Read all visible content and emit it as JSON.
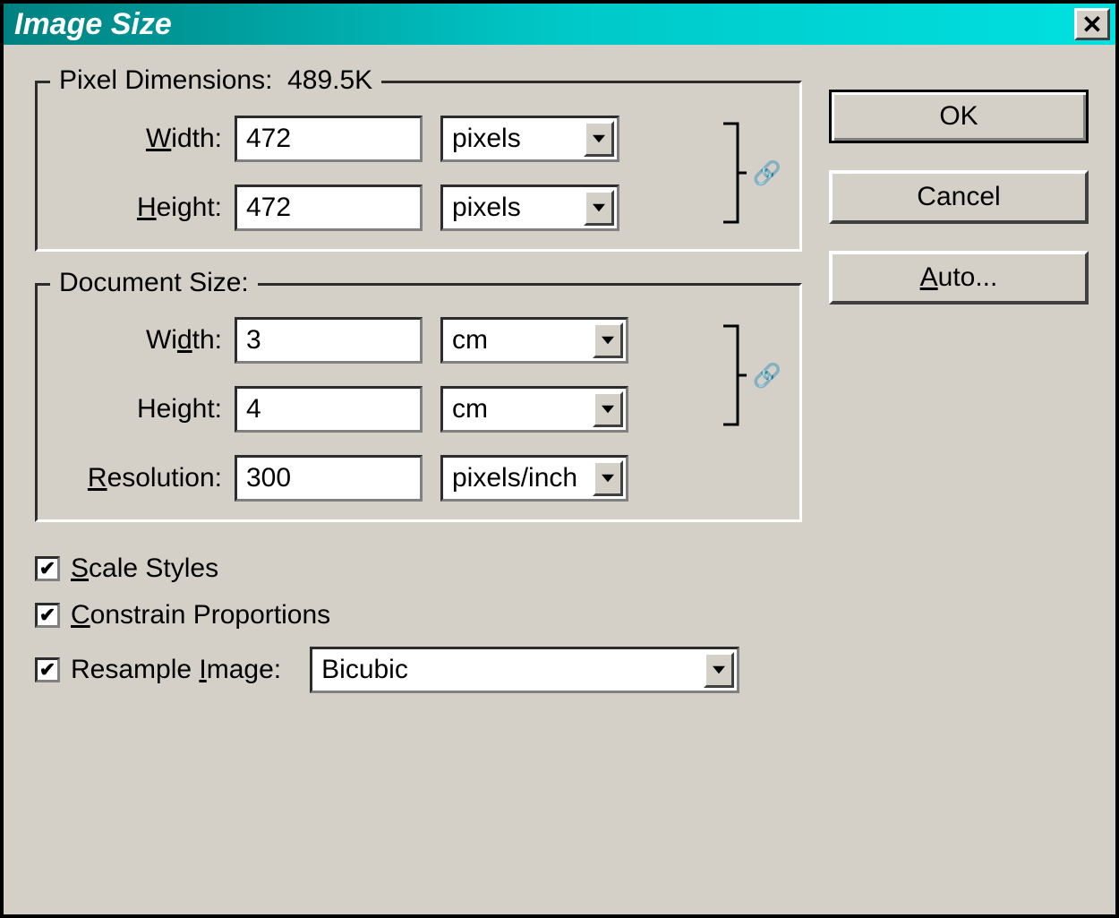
{
  "titlebar": {
    "title": "Image Size"
  },
  "pixel_dimensions": {
    "legend_prefix": "Pixel Dimensions:",
    "file_size": "489.5K",
    "width_label": "Width:",
    "width_value": "472",
    "width_unit": "pixels",
    "height_label": "Height:",
    "height_value": "472",
    "height_unit": "pixels"
  },
  "document_size": {
    "legend": "Document Size:",
    "width_label": "Width:",
    "width_value": "3",
    "width_unit": "cm",
    "height_label": "Height:",
    "height_value": "4",
    "height_unit": "cm",
    "resolution_label": "Resolution:",
    "resolution_value": "300",
    "resolution_unit": "pixels/inch"
  },
  "checkboxes": {
    "scale_styles": "Scale Styles",
    "constrain": "Constrain Proportions",
    "resample": "Resample Image:",
    "resample_method": "Bicubic"
  },
  "buttons": {
    "ok": "OK",
    "cancel": "Cancel",
    "auto": "Auto..."
  }
}
